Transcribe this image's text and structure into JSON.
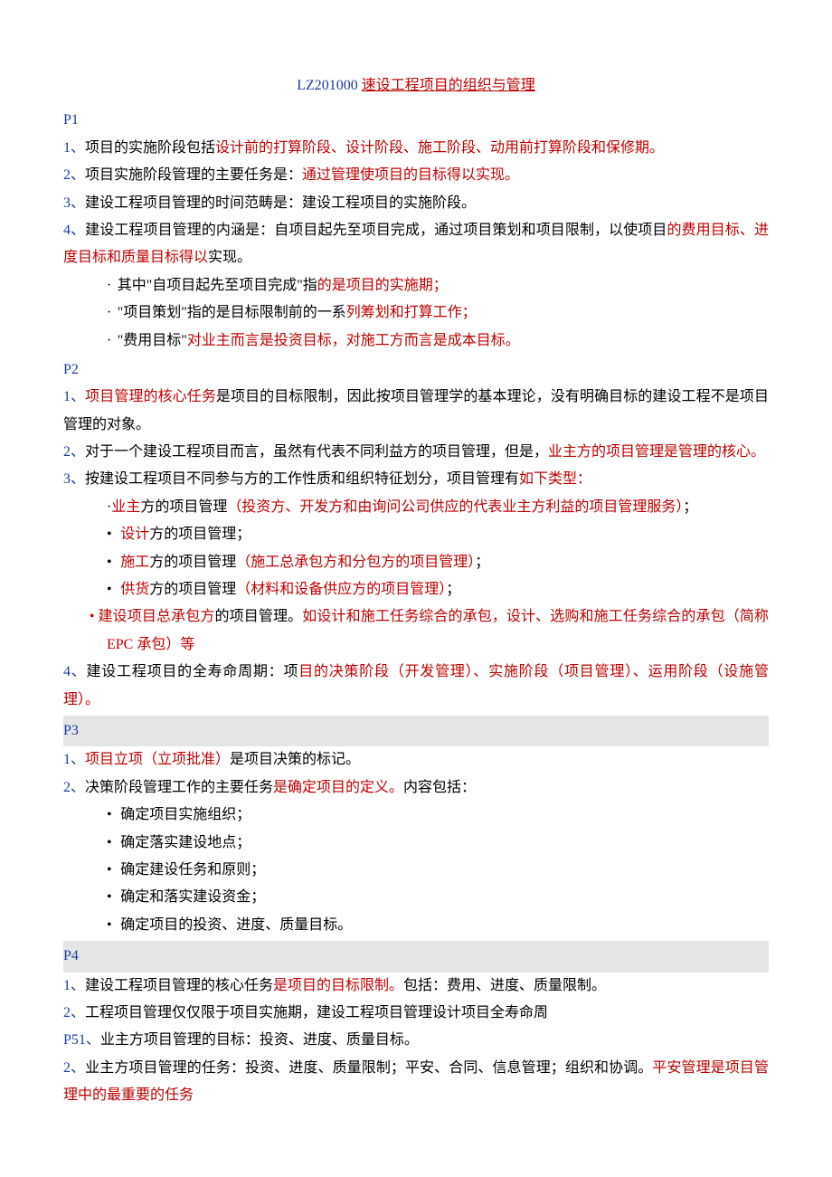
{
  "title": {
    "code_prefix": "LZ201000",
    "rest": "速设工程项目的组织与管理"
  },
  "p1": {
    "label": "P1",
    "i1": {
      "num": "1、",
      "t1": "项目的实施阶段包括",
      "red": "设计前的打算阶段、设计阶段、施工阶段、动用前打算阶段和保修期。"
    },
    "i2": {
      "num": "2、",
      "t1": "项目实施阶段管理的主要任务是：",
      "red": "通过管理使项目的目标得以实现。"
    },
    "i3": {
      "num": "3、",
      "t1": "建设工程项目管理的时间范畴是：建设工程项目的实施阶段。"
    },
    "i4": {
      "num": "4、",
      "t1": "建设工程项目管理的内涵是：自项目起先至项目完成，通过项目策划和项目限制，以使项目",
      "red": "的费用目标、进度目标和质量目标得以",
      "t2": "实现。"
    },
    "b1": {
      "t1": "其中\"自项目起先至项目完成\"指",
      "red": "的是项目的实施期；"
    },
    "b2": {
      "t1": "\"项目策划\"指的是目标限制前的一系",
      "red": "列筹划和打算工作；"
    },
    "b3": {
      "t1": "\"费用目标\"",
      "red": "对业主而言是投资目标，对施工方而言是成本目标。"
    }
  },
  "p2": {
    "label": "P2",
    "i1": {
      "num": "1、",
      "red": "项目管理的核心任务",
      "t1": "是项目的目标限制，因此按项目管理学的基本理论，没有明确目标的建设工程不是项目管理的对象。"
    },
    "i2": {
      "num": "2、",
      "t1": "对于一个建设工程项目而言，虽然有代表不同利益方的项目管理，但是，",
      "red": "业主方的项目管理是管理的核心。"
    },
    "i3": {
      "num": "3、",
      "t1": "按建设工程项目不同参与方的工作性质和组织特征划分，项目管理有",
      "red": "如下类型："
    },
    "b1": {
      "pre": "·",
      "r1": "业主",
      "t1": "方的项目管理",
      "r2": "（投资方、开发方和由询问公司供应的代表业主方利益的项目管理服务）",
      "t2": "；"
    },
    "b2": {
      "r1": "设计",
      "t1": "方的项目管理；"
    },
    "b3": {
      "r1": "施工",
      "t1": "方的项目管理",
      "r2": "（施工总承包方和分包方的项目管理）",
      "t2": "；"
    },
    "b4": {
      "r1": "供货",
      "t1": "方的项目管理",
      "r2": "（材料和设备供应方的项目管理）",
      "t2": "；"
    },
    "b5": {
      "r1": "建设项目总承包方",
      "t1": "的项目管理。",
      "r2": "如设计和施工任务综合的承包，设计、选购和施工任务综合的承包（简称 EPC 承包）等"
    },
    "i4": {
      "num": "4、",
      "t1": "建设工程项目的全寿命周期：项",
      "red": "目的决策阶段（开发管理）、实施阶段（项目管理）、运用阶段（设施管理）。"
    }
  },
  "p3": {
    "label": "P3",
    "i1": {
      "num": "1、",
      "red": "项目立项（立项批准）",
      "t1": "是项目决策的标记。"
    },
    "i2": {
      "num": "2、",
      "t1": "决策阶段管理工作的主要任务",
      "red": "是确定项目的定义。",
      "t2": "内容包括："
    },
    "b1": "确定项目实施组织；",
    "b2": "确定落实建设地点；",
    "b3": "确定建设任务和原则；",
    "b4": "确定和落实建设资金；",
    "b5": "确定项目的投资、进度、质量目标。"
  },
  "p4": {
    "label": "P4",
    "i1": {
      "num": "1、",
      "t1": "建设工程项目管理的核心任务",
      "red": "是项目的目标限制。",
      "t2": "包括：费用、进度、质量限制。"
    },
    "i2": {
      "num": "2、",
      "t1": "工程项目管理仅仅限于项目实施期，建设工程项目管理设计项目全寿命周"
    },
    "p5": {
      "num": "P51、",
      "t1": "业主方项目管理的目标：投资、进度、质量目标。"
    },
    "i2b": {
      "num": "2、",
      "t1": "业主方项目管理的任务：投资、进度、质量限制；平安、合同、信息管理；组织和协调。",
      "red": "平安管理是项目管理中的最重要的任务"
    }
  }
}
